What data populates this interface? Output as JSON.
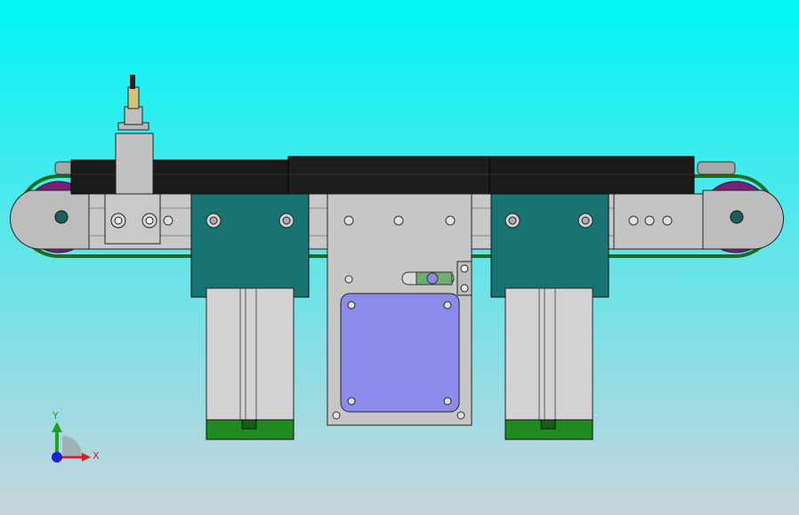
{
  "viewport": {
    "background_top": "#00f5f5",
    "background_bottom": "#c7d4dd"
  },
  "colors": {
    "conveyor_belt": "#1a1a1a",
    "frame_gray": "#c8c8c8",
    "pulley_purple": "#7b1e7a",
    "belt_green": "#1e6b1e",
    "bracket_teal": "#177472",
    "motor_plate_blue": "#8b8bec",
    "cylinder_cap_green": "#1f8a1f",
    "outline": "#222222"
  },
  "triad": {
    "x_label": "X",
    "y_label": "Y",
    "x_color": "#d42020",
    "y_color": "#20a020",
    "z_color": "#2020d0"
  }
}
